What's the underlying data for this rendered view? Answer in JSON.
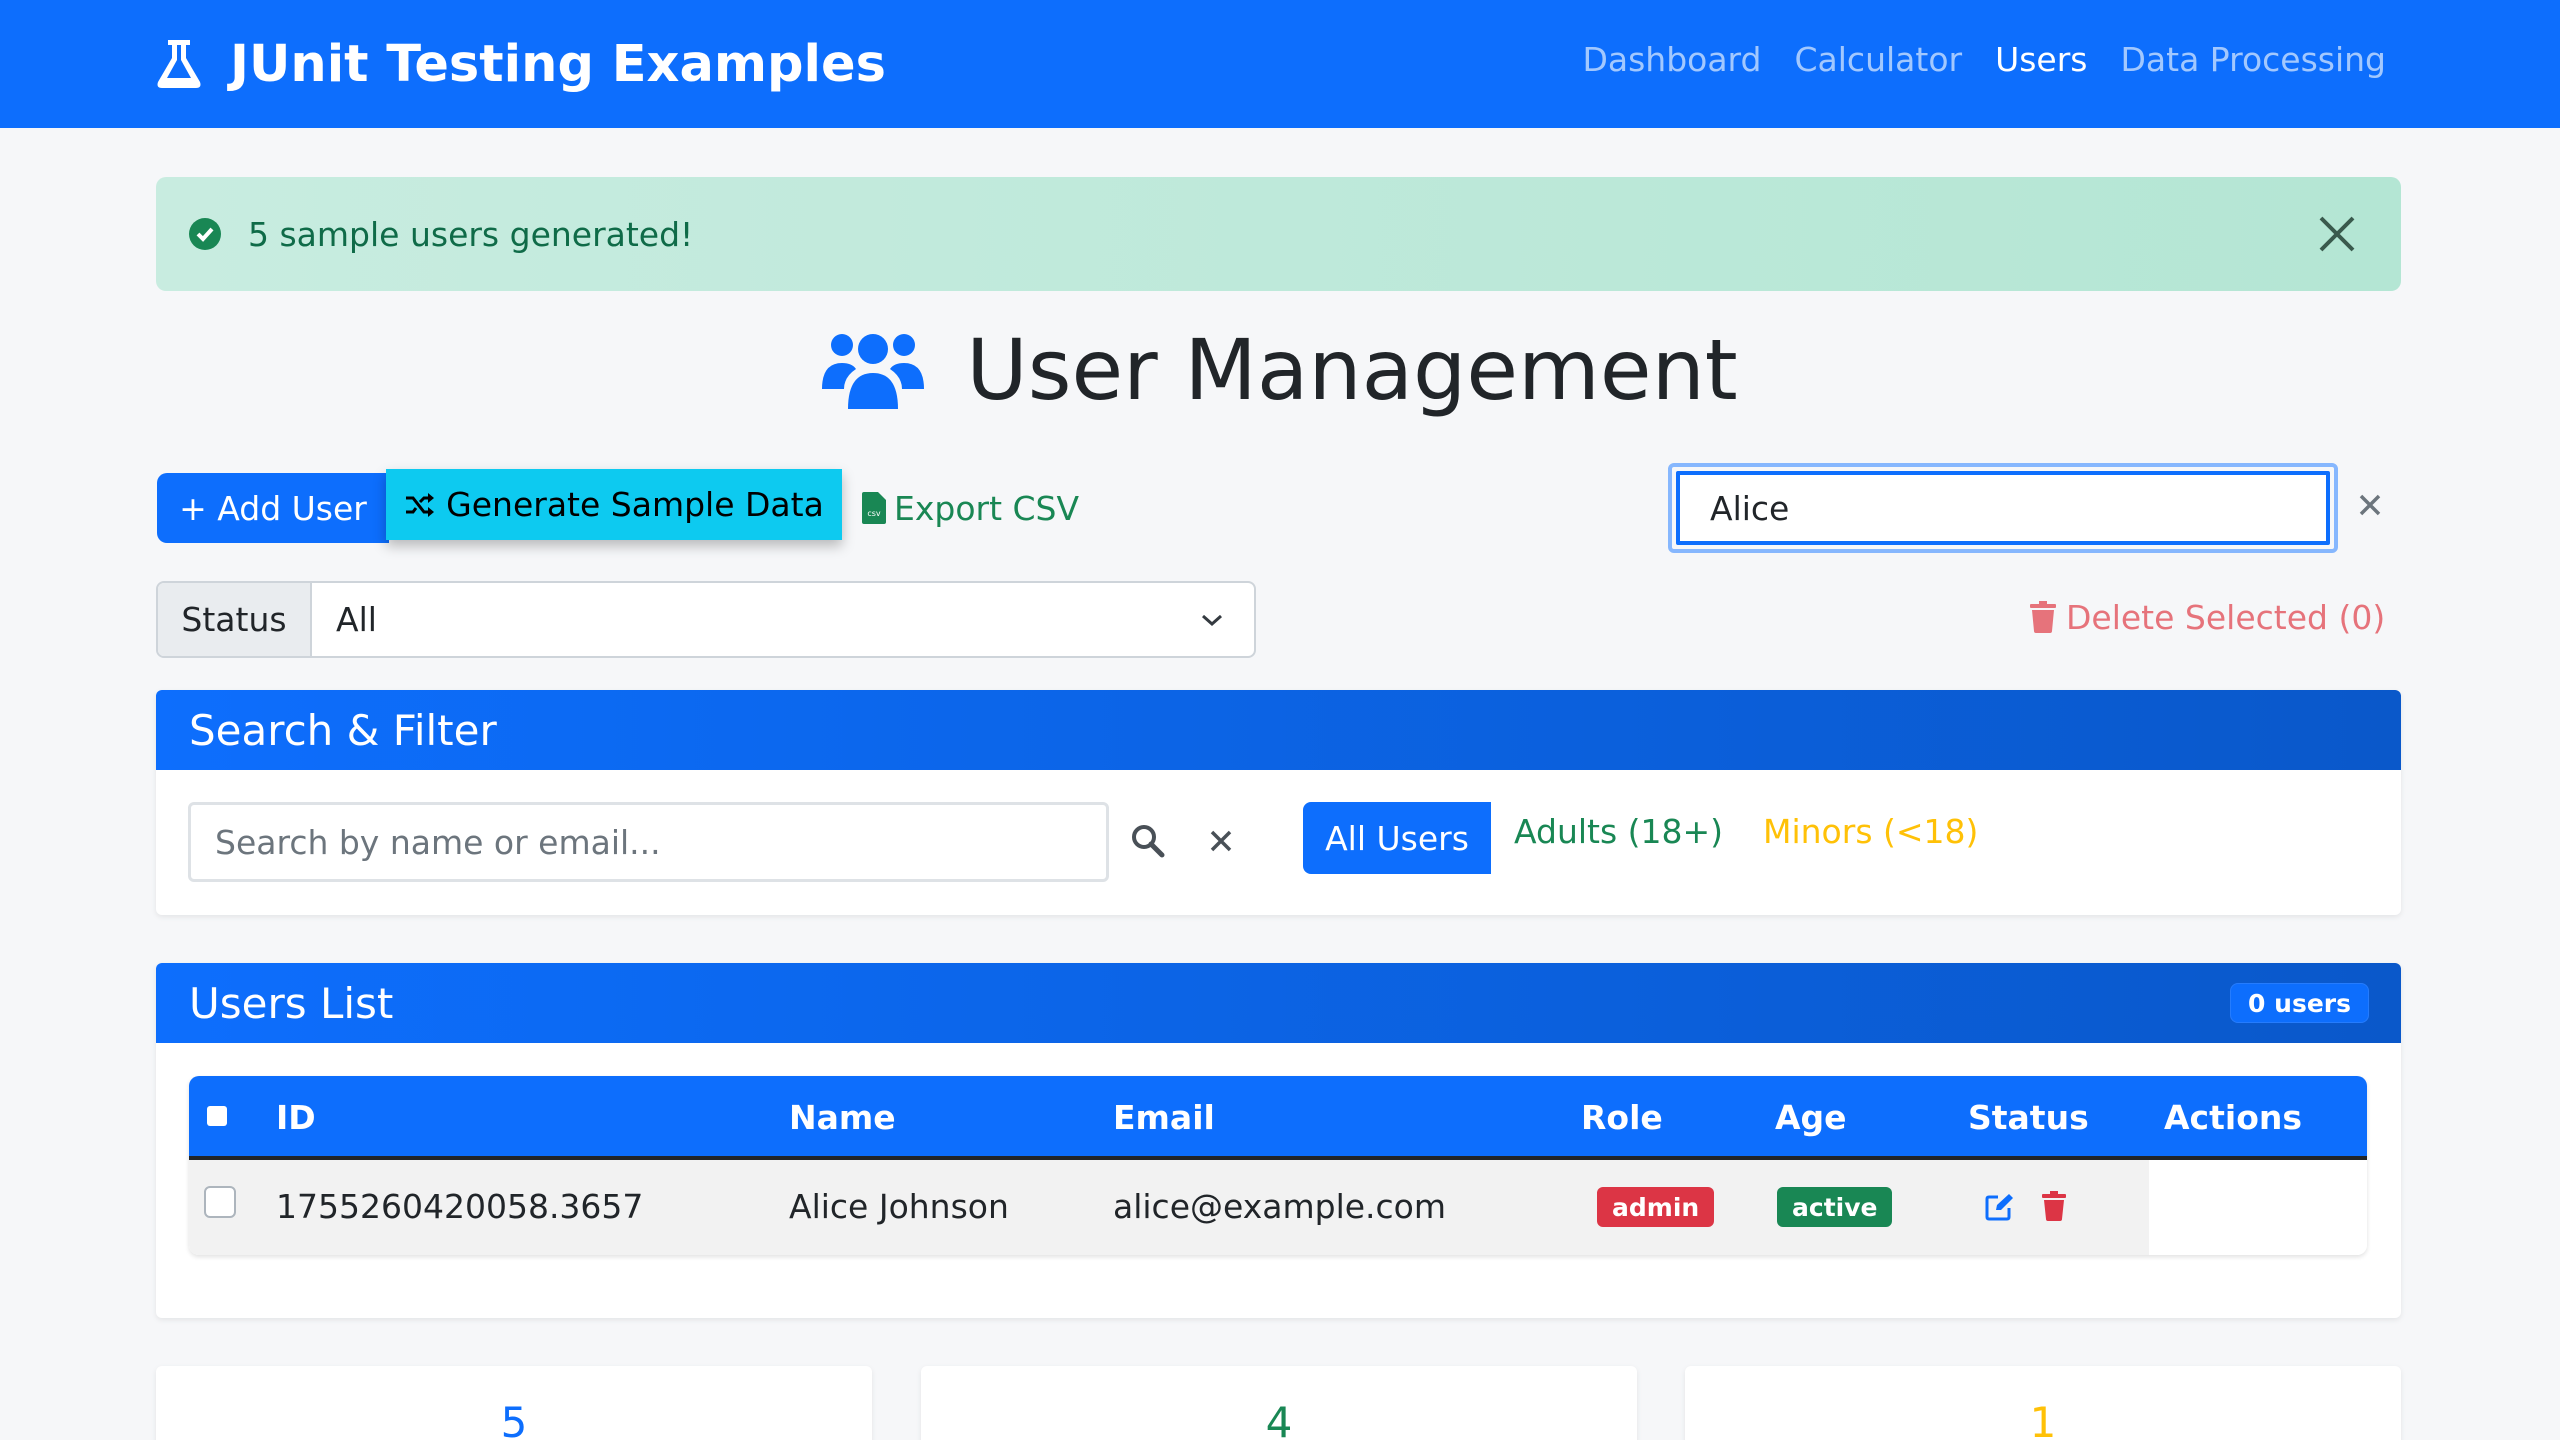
{
  "navbar": {
    "brand": "JUnit Testing Examples",
    "brand_icon": "flask-icon",
    "links": [
      {
        "label": "Dashboard",
        "active": false
      },
      {
        "label": "Calculator",
        "active": false
      },
      {
        "label": "Users",
        "active": true
      },
      {
        "label": "Data Processing",
        "active": false
      }
    ]
  },
  "alert": {
    "message": "5 sample users generated!",
    "icon": "check-circle-icon"
  },
  "page": {
    "title": "User Management",
    "title_icon": "users-icon"
  },
  "toolbar": {
    "add_user": "+ Add User",
    "generate": "Generate Sample Data",
    "export": "Export CSV",
    "search_value": "Alice",
    "delete_selected": "Delete Selected (0)"
  },
  "status_filter": {
    "label": "Status",
    "selected": "All"
  },
  "search_filter": {
    "title": "Search & Filter",
    "placeholder": "Search by name or email...",
    "buttons": {
      "all": "All Users",
      "adults": "Adults (18+)",
      "minors": "Minors (<18)"
    }
  },
  "users_list": {
    "title": "Users List",
    "count_badge": "0 users",
    "columns": [
      "ID",
      "Name",
      "Email",
      "Role",
      "Age",
      "Status",
      "Actions"
    ],
    "rows": [
      {
        "id": "1755260420058.3657",
        "name": "Alice Johnson",
        "email": "alice@example.com",
        "role": "admin",
        "age": "active"
      }
    ]
  },
  "stats": {
    "total": "5",
    "adults": "4",
    "minors": "1"
  },
  "colors": {
    "primary": "#0d6efd",
    "success": "#198754",
    "info": "#0dcaf0",
    "warning": "#ffc107",
    "danger": "#dc3545"
  }
}
